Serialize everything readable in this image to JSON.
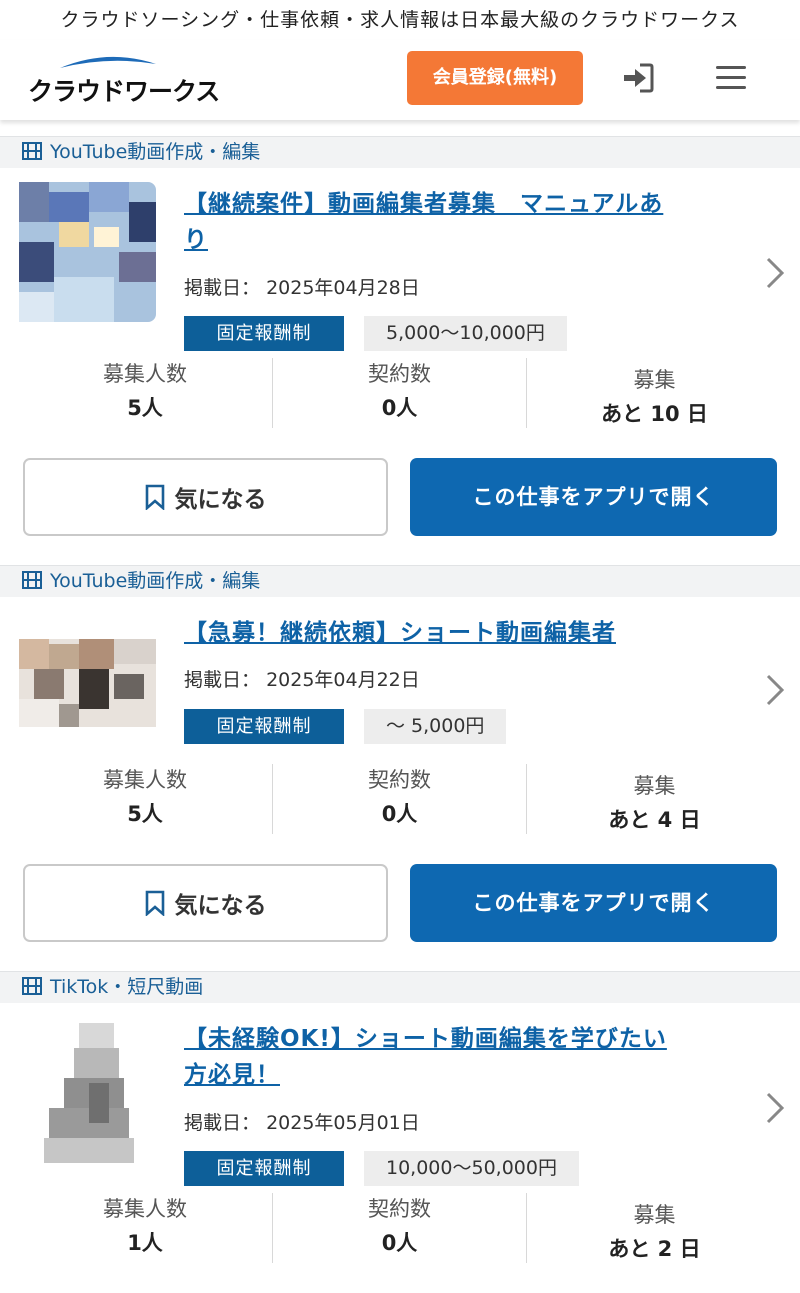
{
  "tagline": "クラウドソーシング・仕事依頼・求人情報は日本最大級のクラウドワークス",
  "header": {
    "logo_text": "クラウドワークス",
    "register_label": "会員登録(無料)",
    "login_icon": "sign-in-icon",
    "menu_icon": "hamburger-menu-icon"
  },
  "colors": {
    "accent_orange": "#f47836",
    "primary_blue": "#0e68b1",
    "link_blue": "#0e62a6"
  },
  "labels": {
    "posted_prefix": "掲載日：",
    "fixed_price": "固定報酬制",
    "applicants": "募集人数",
    "contracts": "契約数",
    "recruiting": "募集",
    "favorite": "気になる",
    "open_app": "この仕事をアプリで開く"
  },
  "jobs": [
    {
      "category": "YouTube動画作成・編集",
      "title_line1": "【継続案件】動画編集者募集　マニュアルあ",
      "title_line2": "り",
      "posted_date": "2025年04月28日",
      "price": "5,000〜10,000円",
      "applicants": "5人",
      "contracts": "0人",
      "days_left": "あと 10 日"
    },
    {
      "category": "YouTube動画作成・編集",
      "title_line1": "【急募！継続依頼】ショート動画編集者",
      "title_line2": "",
      "posted_date": "2025年04月22日",
      "price": "〜 5,000円",
      "applicants": "5人",
      "contracts": "0人",
      "days_left": "あと 4 日"
    },
    {
      "category": "TikTok・短尺動画",
      "title_line1": "【未経験OK!】ショート動画編集を学びたい",
      "title_line2": "方必見！",
      "posted_date": "2025年05月01日",
      "price": "10,000〜50,000円",
      "applicants": "1人",
      "contracts": "0人",
      "days_left": "あと 2 日"
    }
  ]
}
